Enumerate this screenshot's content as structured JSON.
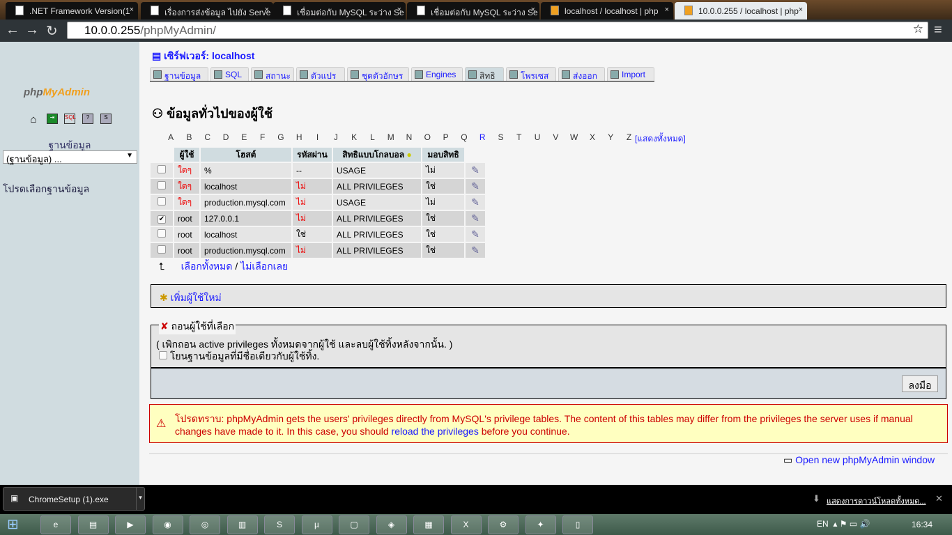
{
  "browser": {
    "tabs": [
      ".NET Framework Version(1",
      "เรื่องการส่งข้อมูล ไปยัง Serve",
      "เชื่อมต่อกับ MySQL ระว่าง Se",
      "เชื่อมต่อกับ MySQL ระว่าง Se",
      "localhost / localhost | php",
      "10.0.0.255 / localhost | php"
    ],
    "url_host": "10.0.0.255",
    "url_path": "/phpMyAdmin/"
  },
  "sidebar": {
    "logo": "phpMyAdmin",
    "db_label": "ฐานข้อมูล",
    "db_select": "(ฐานข้อมูล) ...",
    "choose": "โปรดเลือกฐานข้อมูล"
  },
  "header": {
    "server": "เซิร์ฟเวอร์: localhost",
    "tabs": [
      "ฐานข้อมูล",
      "SQL",
      "สถานะ",
      "ตัวแปร",
      "ชุดตัวอักษร",
      "Engines",
      "สิทธิ",
      "โพรเซส",
      "ส่งออก",
      "Import"
    ],
    "active_tab": "สิทธิ"
  },
  "page": {
    "title": "ข้อมูลทั่วไปของผู้ใช้",
    "letters": [
      "A",
      "B",
      "C",
      "D",
      "E",
      "F",
      "G",
      "H",
      "I",
      "J",
      "K",
      "L",
      "M",
      "N",
      "O",
      "P",
      "Q",
      "R",
      "S",
      "T",
      "U",
      "V",
      "W",
      "X",
      "Y",
      "Z"
    ],
    "show_all": "[แสดงทั้งหมด]"
  },
  "table": {
    "headers": [
      "ผู้ใช้",
      "โฮสต์",
      "รหัสผ่าน",
      "สิทธิแบบโกลบอล",
      "มอบสิทธิ"
    ],
    "rows": [
      {
        "user": "ใดๆ",
        "host": "%",
        "password": "--",
        "global": "USAGE",
        "grant": "ไม่",
        "checked": false
      },
      {
        "user": "ใดๆ",
        "host": "localhost",
        "password": "ไม่",
        "global": "ALL PRIVILEGES",
        "grant": "ใช่",
        "checked": false
      },
      {
        "user": "ใดๆ",
        "host": "production.mysql.com",
        "password": "ไม่",
        "global": "USAGE",
        "grant": "ไม่",
        "checked": false
      },
      {
        "user": "root",
        "host": "127.0.0.1",
        "password": "ไม่",
        "global": "ALL PRIVILEGES",
        "grant": "ใช่",
        "checked": true
      },
      {
        "user": "root",
        "host": "localhost",
        "password": "ใช่",
        "global": "ALL PRIVILEGES",
        "grant": "ใช่",
        "checked": false
      },
      {
        "user": "root",
        "host": "production.mysql.com",
        "password": "ไม่",
        "global": "ALL PRIVILEGES",
        "grant": "ใช่",
        "checked": false
      }
    ]
  },
  "select_all": "เลือกทั้งหมด",
  "separator": " / ",
  "unselect_all": "ไม่เลือกเลย",
  "add_user": "เพิ่มผู้ใช้ใหม่",
  "delete": {
    "legend": "ถอนผู้ใช้ที่เลือก",
    "desc": "( เพิกถอน active privileges ทั้งหมดจากผู้ใช้ และลบผู้ใช้ทิ้งหลังจากนั้น. )",
    "option": "โยนฐานข้อมูลที่มีชื่อเดียวกับผู้ใช้ทิ้ง.",
    "go": "ลงมือ"
  },
  "notice": {
    "prefix": "โปรดทราบ: phpMyAdmin gets the users' privileges directly from MySQL's privilege tables. The content of this tables may differ from the privileges the server uses if manual changes have made to it. In this case, you should ",
    "link": "reload the privileges",
    "suffix": " before you continue."
  },
  "new_window": "Open new phpMyAdmin window",
  "downloads": {
    "file": "ChromeSetup (1).exe",
    "show_all": "แสดงการดาวน์โหลดทั้งหมด..."
  },
  "taskbar": {
    "lang": "EN",
    "time": "16:34"
  }
}
